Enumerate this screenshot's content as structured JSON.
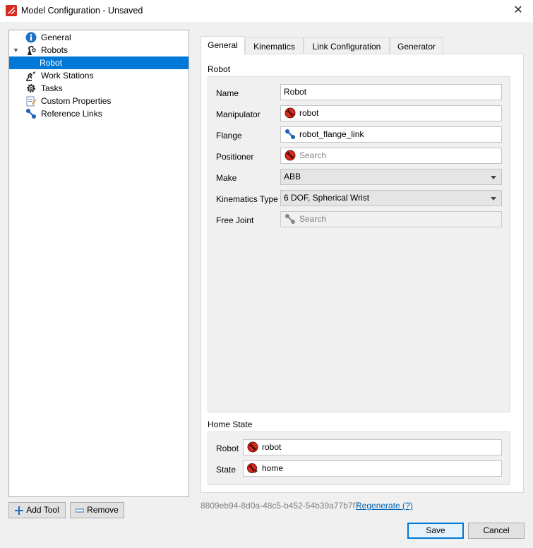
{
  "window": {
    "title": "Model Configuration - Unsaved",
    "close_glyph": "✕"
  },
  "tree": {
    "items": [
      {
        "label": "General",
        "icon": "info-icon"
      },
      {
        "label": "Robots",
        "icon": "robot-arm-icon",
        "expanded": true
      },
      {
        "label": "Robot",
        "selected": true
      },
      {
        "label": "Work Stations",
        "icon": "workstation-icon"
      },
      {
        "label": "Tasks",
        "icon": "gear-icon"
      },
      {
        "label": "Custom Properties",
        "icon": "edit-properties-icon"
      },
      {
        "label": "Reference Links",
        "icon": "link-icon"
      }
    ]
  },
  "buttons": {
    "add_tool": "Add Tool",
    "remove": "Remove",
    "save": "Save",
    "cancel": "Cancel"
  },
  "tabs": [
    "General",
    "Kinematics",
    "Link Configuration",
    "Generator"
  ],
  "robot_group": {
    "title": "Robot",
    "name_label": "Name",
    "name_value": "Robot",
    "manipulator_label": "Manipulator",
    "manipulator_value": "robot",
    "flange_label": "Flange",
    "flange_value": "robot_flange_link",
    "positioner_label": "Positioner",
    "positioner_placeholder": "Search",
    "make_label": "Make",
    "make_value": "ABB",
    "kinematics_type_label": "Kinematics Type",
    "kinematics_type_value": "6 DOF, Spherical Wrist",
    "free_joint_label": "Free Joint",
    "free_joint_placeholder": "Search"
  },
  "home_state_group": {
    "title": "Home State",
    "robot_label": "Robot",
    "robot_value": "robot",
    "state_label": "State",
    "state_value": "home"
  },
  "footer": {
    "uuid": "8809eb94-8d0a-48c5-b452-54b39a77b7f7",
    "regenerate_link": "Regenerate (?)"
  },
  "colors": {
    "selection": "#0078d7",
    "link": "#0063b1",
    "accent_red": "#d62a1e"
  }
}
